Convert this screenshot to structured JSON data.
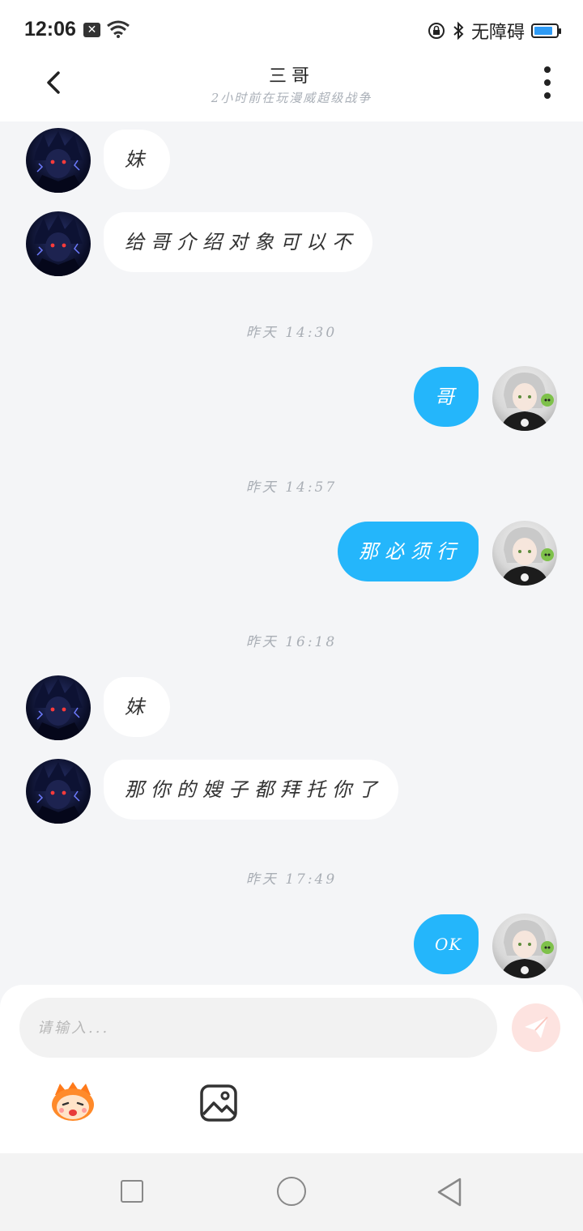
{
  "status_bar": {
    "time": "12:06",
    "notification_icon": "x-box-icon",
    "wifi_icon": "wifi-icon",
    "lock_icon": "lock-rotation-icon",
    "bluetooth_icon": "bluetooth-icon",
    "accessibility_label": "无障碍",
    "battery_level": 0.85,
    "battery_color": "#2f9bf5"
  },
  "header": {
    "title": "三哥",
    "subtitle": "2小时前在玩漫威超级战争",
    "back_icon": "chevron-left-icon",
    "more_icon": "more-vertical-icon"
  },
  "messages": [
    {
      "side": "in",
      "text": "妹"
    },
    {
      "side": "in",
      "text": "给哥介绍对象可以不"
    },
    {
      "type": "timestamp",
      "text": "昨天 14:30"
    },
    {
      "side": "out",
      "text": "哥"
    },
    {
      "type": "timestamp",
      "text": "昨天 14:57"
    },
    {
      "side": "out",
      "text": "那必须行"
    },
    {
      "type": "timestamp",
      "text": "昨天 16:18"
    },
    {
      "side": "in",
      "text": "妹"
    },
    {
      "side": "in",
      "text": "那你的嫂子都拜托你了"
    },
    {
      "type": "timestamp",
      "text": "昨天 17:49"
    },
    {
      "side": "out",
      "text": "OK"
    }
  ],
  "input": {
    "placeholder": "请输入...",
    "send_icon": "paper-plane-icon",
    "emoji_icon": "emoji-face-icon",
    "image_icon": "image-icon"
  },
  "colors": {
    "outgoing_bubble": "#24b6fb",
    "incoming_bubble": "#ffffff",
    "send_button": "#fde3e0"
  },
  "nav_bar": {
    "recents_icon": "square-icon",
    "home_icon": "circle-icon",
    "back_icon": "triangle-back-icon"
  }
}
